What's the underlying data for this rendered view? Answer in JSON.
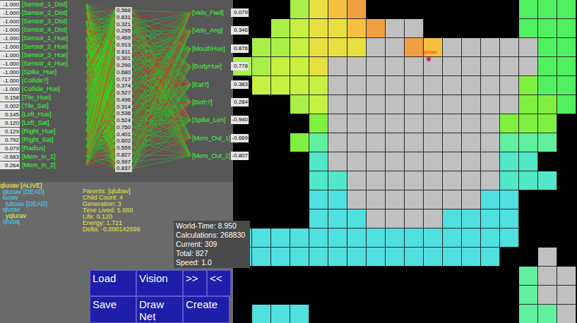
{
  "neural_net": {
    "inputs": [
      {
        "label": "[Sensor_1_Dist]",
        "value": "-1.000"
      },
      {
        "label": "[Sensor_2_Dist]",
        "value": "-1.000"
      },
      {
        "label": "[Sensor_3_Dist]",
        "value": "-1.000"
      },
      {
        "label": "[Sensor_4_Dist]",
        "value": "-1.000"
      },
      {
        "label": "[Sensor_1_Hue]",
        "value": "-1.000"
      },
      {
        "label": "[Sensor_2_Hue]",
        "value": "-1.000"
      },
      {
        "label": "[Sensor_3_Hue]",
        "value": "-1.000"
      },
      {
        "label": "[Sensor_4_Hue]",
        "value": "-1.000"
      },
      {
        "label": "[Spike_Hue]",
        "value": "-1.000"
      },
      {
        "label": "[Collide?]",
        "value": "-1.000"
      },
      {
        "label": "[Collide_Hue]",
        "value": "-1.000"
      },
      {
        "label": "[Tile_Hue]",
        "value": "0.158"
      },
      {
        "label": "[Tile_Sat]",
        "value": "0.002"
      },
      {
        "label": "[Left_Hue]",
        "value": "0.145"
      },
      {
        "label": "[Left_Sat]",
        "value": "0.120"
      },
      {
        "label": "[Right_Hue]",
        "value": "0.129"
      },
      {
        "label": "[Right_Sat]",
        "value": "0.792"
      },
      {
        "label": "[Radius]",
        "value": "0.079"
      },
      {
        "label": "[Mem_In_1]",
        "value": "-0.683"
      },
      {
        "label": "[Mem_In_2]",
        "value": "0.264"
      }
    ],
    "hidden": [
      "0.568",
      "0.831",
      "0.321",
      "0.295",
      "0.469",
      "0.913",
      "0.811",
      "0.301",
      "0.290",
      "0.680",
      "0.717",
      "0.374",
      "0.527",
      "0.496",
      "0.314",
      "0.536",
      "0.524",
      "0.750",
      "0.401",
      "0.602",
      "0.559",
      "0.827",
      "0.997",
      "0.837"
    ],
    "outputs": [
      {
        "label": "[Velo_Fwd]",
        "value": "0.079"
      },
      {
        "label": "[Velo_Ang]",
        "value": "0.346"
      },
      {
        "label": "[MouthHue]",
        "value": "0.876"
      },
      {
        "label": "[BodyHue]",
        "value": "0.778"
      },
      {
        "label": "[Eat?]",
        "value": "0.383"
      },
      {
        "label": "[Birth?]",
        "value": "0.284"
      },
      {
        "label": "[Spike_Len]",
        "value": "-0.940"
      },
      {
        "label": "[Mem_Out_1]",
        "value": "-0.669"
      },
      {
        "label": "[Mem_Out_2]",
        "value": "-0.807"
      }
    ]
  },
  "lineage": [
    {
      "text": "qluoav [ALIVE]",
      "depth": 0,
      "color": "#ffff40"
    },
    {
      "text": "qluoav [DEAD]",
      "depth": 1,
      "color": "#40d8ff"
    },
    {
      "text": "luoav",
      "depth": 1,
      "color": "#40d8ff"
    },
    {
      "text": "luboav [DEAD]",
      "depth": 2,
      "color": "#40d8ff"
    },
    {
      "text": "qlurav",
      "depth": 1,
      "color": "#40d8ff"
    },
    {
      "text": "yqlurav",
      "depth": 2,
      "color": "#e0ff40"
    },
    {
      "text": "qluoaj",
      "depth": 1,
      "color": "#40d8ff"
    }
  ],
  "selected_creature": [
    "Parents: [qlubav]",
    "Child Count: 4",
    "Generation: 3",
    "Time Lived: 5.680",
    "Life: 0.120",
    "Energy: 1.721",
    "Delta: -0.000142699"
  ],
  "world_stats": [
    "World-Time: 8.950",
    "Calculations: 268830",
    "Current: 309",
    "Total: 827",
    "Speed: 1.0"
  ],
  "buttons": [
    {
      "label": "Load",
      "kind": "wide"
    },
    {
      "label": "Vision",
      "kind": "wide"
    },
    {
      "label": ">>",
      "kind": "narrow"
    },
    {
      "label": "<<",
      "kind": "narrow"
    },
    {
      "label": "Save",
      "kind": "wide"
    },
    {
      "label": "Draw Net",
      "kind": "wide"
    },
    {
      "label": "Create",
      "kind": "wide"
    }
  ],
  "map": {
    "palette": {
      "K": "#000000",
      "O": "#f0a040",
      "o": "#f5c040",
      "Y": "#e8e040",
      "y": "#c8f040",
      "L": "#a8f048",
      "G": "#80f040",
      "g": "#50f060",
      "M": "#60f0a0",
      "T": "#50e8c8",
      "C": "#50e0e0",
      "S": "#c0c0c0"
    },
    "rows": [
      "KKKLYoOKKKKKKKKggg",
      "KKLyYYoOSSKKKKKggg",
      "KLLyYYYSSOoSSSSSgg",
      "LLyyYSSSSSSSSSSSgg",
      "KyyyySSSSSSSSSSGgg",
      "KKKLySSSSSSSSSSGGg",
      "KKKKGSSSSSSSSSGGGK",
      "KKKGMSSSSSSSSSMMMK",
      "KKKKTSSSSSSSSSTTKK",
      "KKKKTTSSSSSSSSTTTK",
      "KKKKCCSSSSSSSCCKKK",
      "KKKKCCCSSSSCCCCKKK",
      "CCCCCCCCCCCCCCCKKK",
      "CCCCCCCCCCCCCCKKSK",
      "KKKKKKKKKKKKKKKMSS",
      "KKKKKKKKKKKKKKKMSS",
      "KCCCKKKKKKKKKKKMMS"
    ],
    "creatures": [
      {
        "label": "qluoav",
        "color": "#e0207a"
      }
    ]
  }
}
